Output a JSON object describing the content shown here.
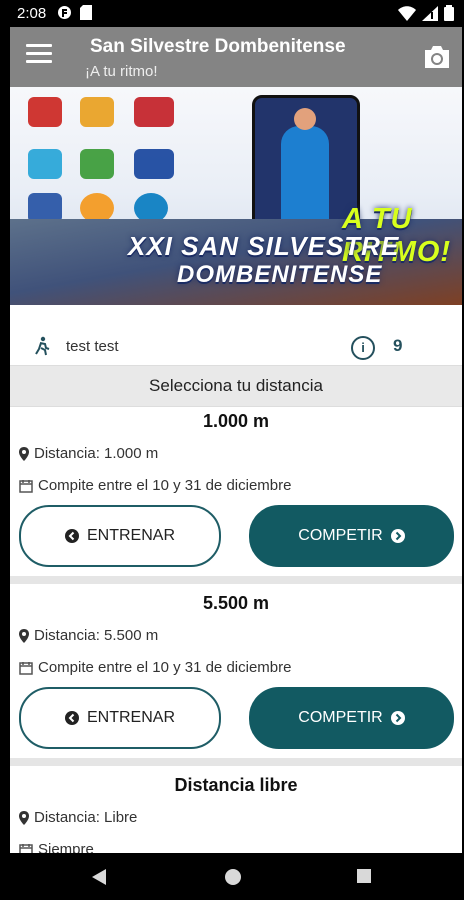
{
  "status": {
    "time": "2:08",
    "left_icons": [
      "app-icon",
      "sd-card-icon"
    ],
    "right_icons": [
      "wifi-icon",
      "signal-icon",
      "battery-icon"
    ]
  },
  "appbar": {
    "title": "San Silvestre Dombenitense",
    "subtitle": "¡A tu ritmo!",
    "menu_icon": "menu-icon",
    "camera_icon": "camera-icon"
  },
  "banner": {
    "tagline": "A TU RITMO!",
    "title_line1": "XXI SAN SILVESTRE",
    "title_line2": "DOMBENITENSE",
    "logos": [
      "logo-ayuntamiento",
      "logo-dmg",
      "logo-diputacion-badajoz",
      "logo-deportes",
      "logo-extremadura",
      "logo-olimpia",
      "logo-club",
      "logo-burger-king",
      "logo-caixa"
    ]
  },
  "user": {
    "name": "test test",
    "count": "9"
  },
  "section": {
    "title": "Selecciona tu distancia"
  },
  "distances": [
    {
      "title": "1.000 m",
      "distance_line": "Distancia: 1.000 m",
      "schedule_line": "Compite entre el 10 y 31 de diciembre",
      "train_label": "ENTRENAR",
      "compete_label": "COMPETIR"
    },
    {
      "title": "5.500 m",
      "distance_line": "Distancia: 5.500 m",
      "schedule_line": "Compite entre el 10 y 31 de diciembre",
      "train_label": "ENTRENAR",
      "compete_label": "COMPETIR"
    },
    {
      "title": "Distancia libre",
      "distance_line": "Distancia: Libre",
      "schedule_line": "Siempre"
    }
  ],
  "colors": {
    "appbar": "#848484",
    "accent": "#125a62"
  }
}
